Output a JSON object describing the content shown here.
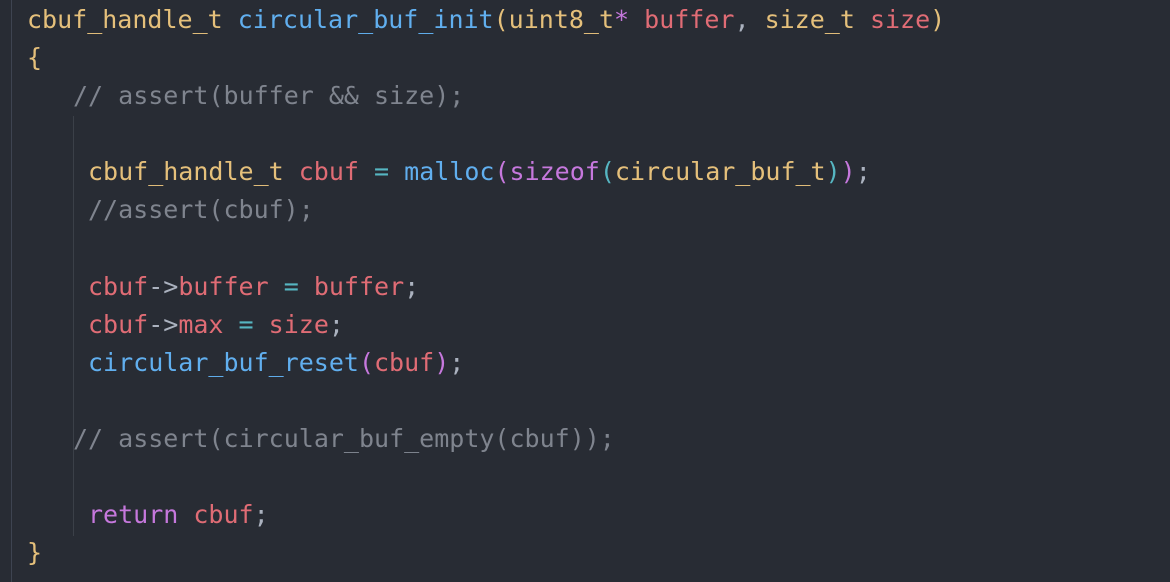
{
  "code": {
    "lines": [
      {
        "indent": 0,
        "tokens": [
          {
            "t": "cbuf_handle_t",
            "c": "type"
          },
          {
            "t": " ",
            "c": "p"
          },
          {
            "t": "circular_buf_init",
            "c": "fn"
          },
          {
            "t": "(",
            "c": "b1"
          },
          {
            "t": "uint8_t",
            "c": "type"
          },
          {
            "t": "*",
            "c": "kw"
          },
          {
            "t": " ",
            "c": "p"
          },
          {
            "t": "buffer",
            "c": "var"
          },
          {
            "t": ", ",
            "c": "p"
          },
          {
            "t": "size_t",
            "c": "type"
          },
          {
            "t": " ",
            "c": "p"
          },
          {
            "t": "size",
            "c": "var"
          },
          {
            "t": ")",
            "c": "b1"
          }
        ]
      },
      {
        "indent": 0,
        "tokens": [
          {
            "t": "{",
            "c": "b1"
          }
        ]
      },
      {
        "indent": 1,
        "tokens": [
          {
            "t": "// assert(buffer && size);",
            "c": "cm"
          }
        ]
      },
      {
        "indent": 0,
        "tokens": []
      },
      {
        "indent": 2,
        "tokens": [
          {
            "t": "cbuf_handle_t",
            "c": "type"
          },
          {
            "t": " ",
            "c": "p"
          },
          {
            "t": "cbuf",
            "c": "var"
          },
          {
            "t": " ",
            "c": "p"
          },
          {
            "t": "=",
            "c": "op"
          },
          {
            "t": " ",
            "c": "p"
          },
          {
            "t": "malloc",
            "c": "fn"
          },
          {
            "t": "(",
            "c": "b2"
          },
          {
            "t": "sizeof",
            "c": "kw"
          },
          {
            "t": "(",
            "c": "b3"
          },
          {
            "t": "circular_buf_t",
            "c": "type"
          },
          {
            "t": ")",
            "c": "b3"
          },
          {
            "t": ")",
            "c": "b2"
          },
          {
            "t": ";",
            "c": "p"
          }
        ]
      },
      {
        "indent": 2,
        "tokens": [
          {
            "t": "//assert(cbuf);",
            "c": "cm"
          }
        ]
      },
      {
        "indent": 0,
        "tokens": []
      },
      {
        "indent": 2,
        "tokens": [
          {
            "t": "cbuf",
            "c": "var"
          },
          {
            "t": "->",
            "c": "p"
          },
          {
            "t": "buffer",
            "c": "var"
          },
          {
            "t": " ",
            "c": "p"
          },
          {
            "t": "=",
            "c": "op"
          },
          {
            "t": " ",
            "c": "p"
          },
          {
            "t": "buffer",
            "c": "var"
          },
          {
            "t": ";",
            "c": "p"
          }
        ]
      },
      {
        "indent": 2,
        "tokens": [
          {
            "t": "cbuf",
            "c": "var"
          },
          {
            "t": "->",
            "c": "p"
          },
          {
            "t": "max",
            "c": "var"
          },
          {
            "t": " ",
            "c": "p"
          },
          {
            "t": "=",
            "c": "op"
          },
          {
            "t": " ",
            "c": "p"
          },
          {
            "t": "size",
            "c": "var"
          },
          {
            "t": ";",
            "c": "p"
          }
        ]
      },
      {
        "indent": 2,
        "tokens": [
          {
            "t": "circular_buf_reset",
            "c": "fn"
          },
          {
            "t": "(",
            "c": "b2"
          },
          {
            "t": "cbuf",
            "c": "var"
          },
          {
            "t": ")",
            "c": "b2"
          },
          {
            "t": ";",
            "c": "p"
          }
        ]
      },
      {
        "indent": 0,
        "tokens": []
      },
      {
        "indent": 1,
        "tokens": [
          {
            "t": "// assert(circular_buf_empty(cbuf));",
            "c": "cm"
          }
        ]
      },
      {
        "indent": 0,
        "tokens": []
      },
      {
        "indent": 2,
        "tokens": [
          {
            "t": "return",
            "c": "kw"
          },
          {
            "t": " ",
            "c": "p"
          },
          {
            "t": "cbuf",
            "c": "var"
          },
          {
            "t": ";",
            "c": "p"
          }
        ]
      },
      {
        "indent": 0,
        "tokens": [
          {
            "t": "}",
            "c": "b1"
          }
        ]
      }
    ]
  },
  "theme": {
    "background": "#282c34",
    "type": "#e5c07b",
    "function": "#61afef",
    "variable": "#e06c75",
    "keyword": "#c678dd",
    "comment": "#7f848e",
    "operator": "#56b6c2",
    "punctuation": "#abb2bf"
  }
}
